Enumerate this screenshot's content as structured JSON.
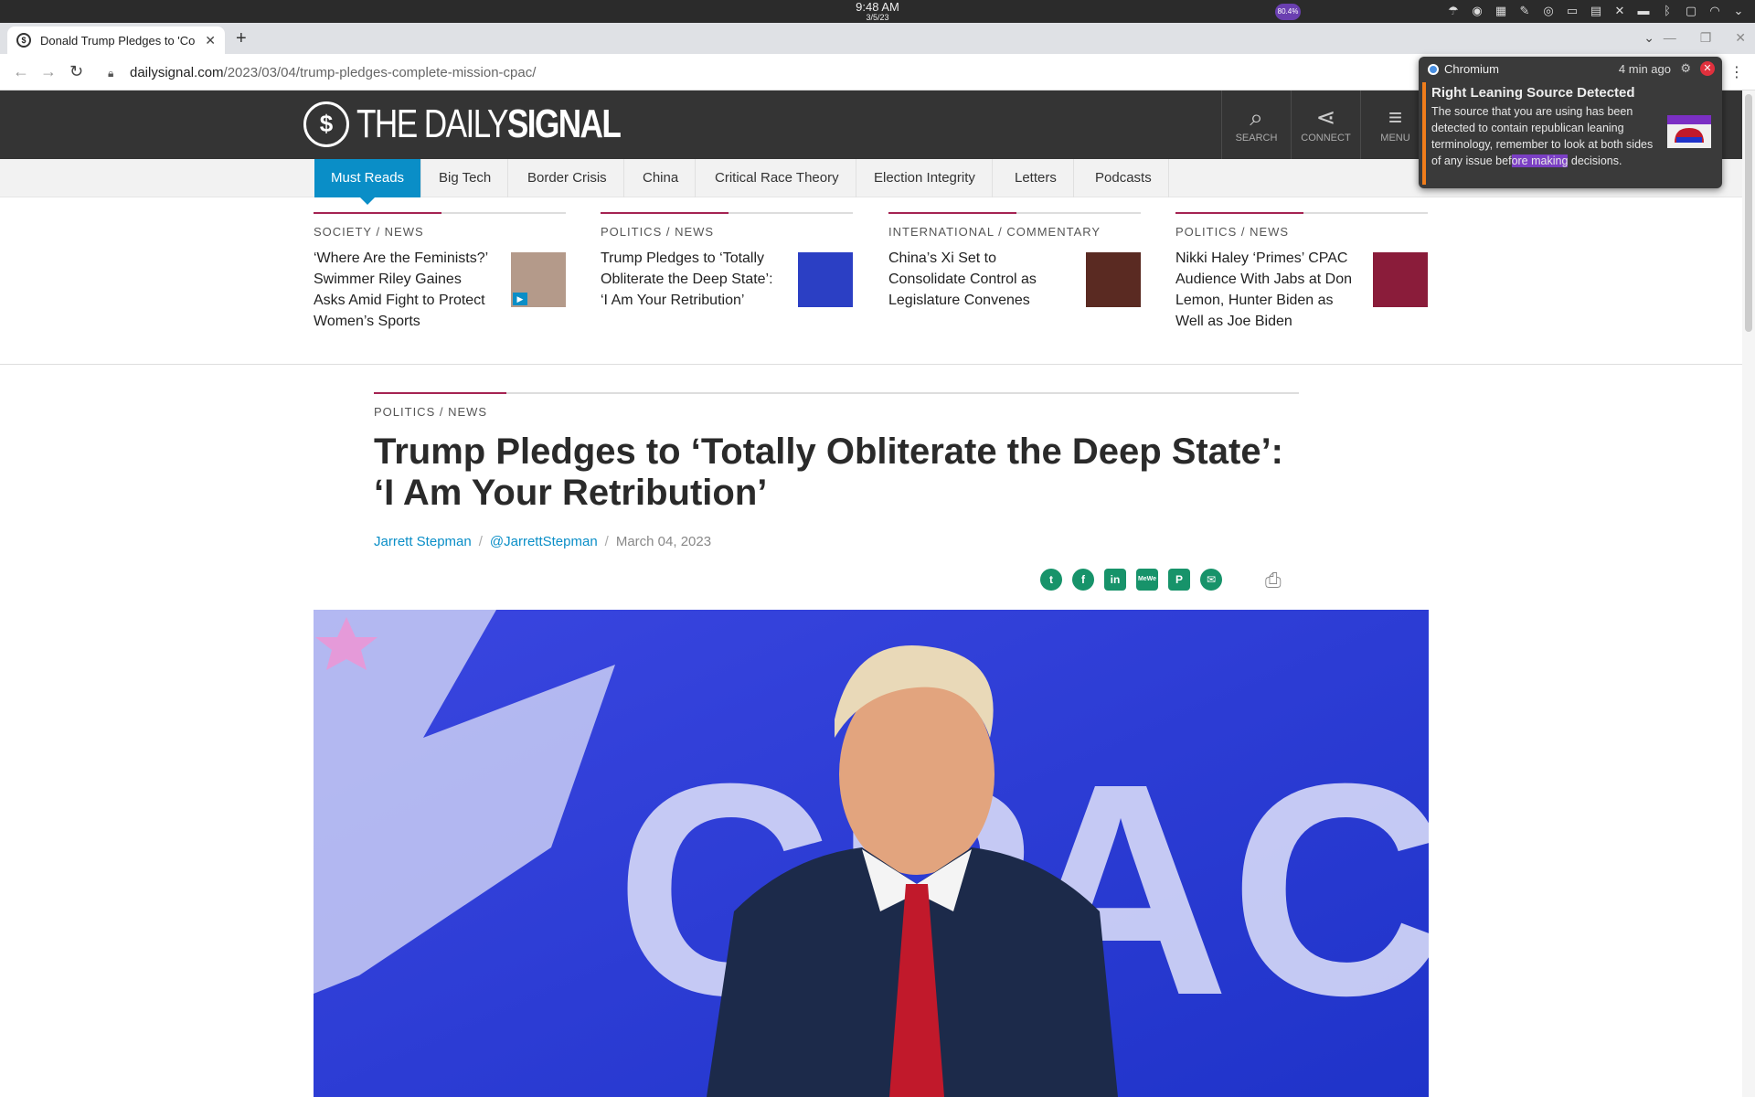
{
  "system_bar": {
    "time": "9:48 AM",
    "date": "3/5/23",
    "cpu": "80.4%"
  },
  "browser": {
    "tab_title": "Donald Trump Pledges to 'Co",
    "tab_favicon": "$",
    "url_host": "dailysignal.com",
    "url_path": "/2023/03/04/trump-pledges-complete-mission-cpac/"
  },
  "site": {
    "logo_prefix": "THE DAILY",
    "logo_bold": "SIGNAL",
    "header_buttons": [
      {
        "label": "SEARCH",
        "icon": "search-icon"
      },
      {
        "label": "CONNECT",
        "icon": "share-icon"
      },
      {
        "label": "MENU",
        "icon": "hamburger-icon"
      }
    ],
    "nav": [
      "Must Reads",
      "Big Tech",
      "Border Crisis",
      "China",
      "Critical Race Theory",
      "Election Integrity",
      "Letters",
      "Podcasts"
    ]
  },
  "teasers": [
    {
      "category": "SOCIETY / NEWS",
      "headline": "‘Where Are the Feminists?’ Swimmer Riley Gaines Asks Amid Fight to Protect Women’s Sports",
      "thumb_color": "#b49a8a"
    },
    {
      "category": "POLITICS / NEWS",
      "headline": "Trump Pledges to ‘Totally Obliterate the Deep State’: ‘I Am Your Retribution’",
      "thumb_color": "#2b3fc4"
    },
    {
      "category": "INTERNATIONAL / COMMENTARY",
      "headline": "China’s Xi Set to Consolidate Control as Legislature Convenes",
      "thumb_color": "#5a2a22"
    },
    {
      "category": "POLITICS / NEWS",
      "headline": "Nikki Haley ‘Primes’ CPAC Audience With Jabs at Don Lemon, Hunter Biden as Well as Joe Biden",
      "thumb_color": "#8a1c3a"
    }
  ],
  "article": {
    "category": "POLITICS / NEWS",
    "title": "Trump Pledges to ‘Totally Obliterate the Deep State’: ‘I Am Your Retribution’",
    "author": "Jarrett Stepman",
    "handle": "@JarrettStepman",
    "date": "March 04, 2023",
    "share_icons": [
      "twitter-icon",
      "facebook-icon",
      "linkedin-icon",
      "mewe-icon",
      "parler-icon",
      "email-icon"
    ],
    "hero_text": "CPAC"
  },
  "notification": {
    "app": "Chromium",
    "time": "4 min ago",
    "title": "Right Leaning Source Detected",
    "body_start": "The source that you are using has been detected to contain republican leaning terminology, remember to look at both sides of any issue bef",
    "body_highlight": "ore making",
    "body_end": " decisions."
  }
}
